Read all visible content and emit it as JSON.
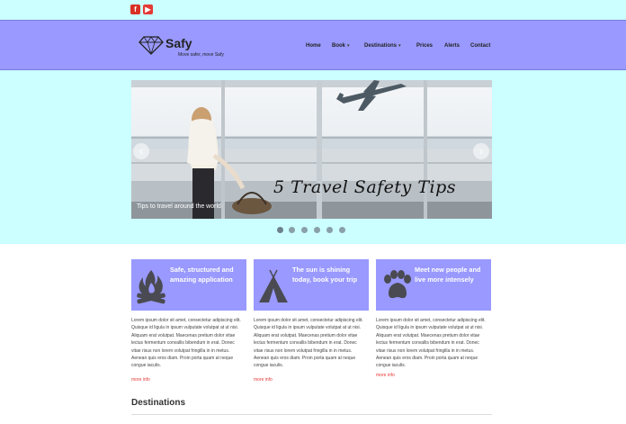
{
  "social": {
    "facebook_icon": "facebook-icon",
    "youtube_icon": "youtube-icon",
    "facebook_glyph": "f",
    "youtube_glyph": "▶"
  },
  "brand": {
    "name": "Safy",
    "tagline": "Move safer, move Safy",
    "logo_icon": "diamond-icon"
  },
  "nav": {
    "home": "Home",
    "book": "Book",
    "destinations": "Destinations",
    "prices": "Prices",
    "alerts": "Alerts",
    "contact": "Contact"
  },
  "slider": {
    "caption": "Tips to travel around the world",
    "overlay_text": "5 Travel Safety Tips",
    "prev_icon": "chevron-left-icon",
    "next_icon": "chevron-right-icon",
    "slide_count": 6,
    "active_slide": 1
  },
  "features": [
    {
      "title": "Safe, structured and amazing application",
      "icon": "campfire-icon",
      "body": "Lorem ipsum dolor sit amet, consectetur adipiscing elit. Quisque id ligula in ipsum vulputate volutpat at ut nisi. Aliquam erat volutpat. Maecenas pretium dolor vitae lectus fermentum convallis bibendum in erat. Donec vitae risus non lorem volutpat fringilla in in metus. Aenean quis eros diam. Proin porta quam at neque congue iaculis.",
      "more": "more info"
    },
    {
      "title": "The sun is shining today, book your trip",
      "icon": "tent-icon",
      "body": "Lorem ipsum dolor sit amet, consectetur adipiscing elit. Quisque id ligula in ipsum vulputate volutpat at ut nisi. Aliquam erat volutpat. Maecenas pretium dolor vitae lectus fermentum convallis bibendum in erat. Donec vitae risus non lorem volutpat fringilla in in metus. Aenean quis eros diam. Proin porta quam at neque congue iaculis.",
      "more": "more info"
    },
    {
      "title": "Meet new people and live more intensely",
      "icon": "paw-icon",
      "body": "Lorem ipsum dolor sit amet, consectetur adipiscing elit. Quisque id ligula in ipsum vulputate volutpat at ut nisi. Aliquam erat volutpat. Maecenas pretium dolor vitae lectus fermentum convallis bibendum in erat. Donec vitae risus non lorem volutpat fringilla in in metus. Aenean quis eros diam. Proin porta quam at neque congue iaculis.",
      "more": "more info"
    }
  ],
  "destinations": {
    "heading": "Destinations"
  },
  "colors": {
    "topbar": "#ccffff",
    "header": "#9999ff",
    "link_more": "#e53935"
  }
}
